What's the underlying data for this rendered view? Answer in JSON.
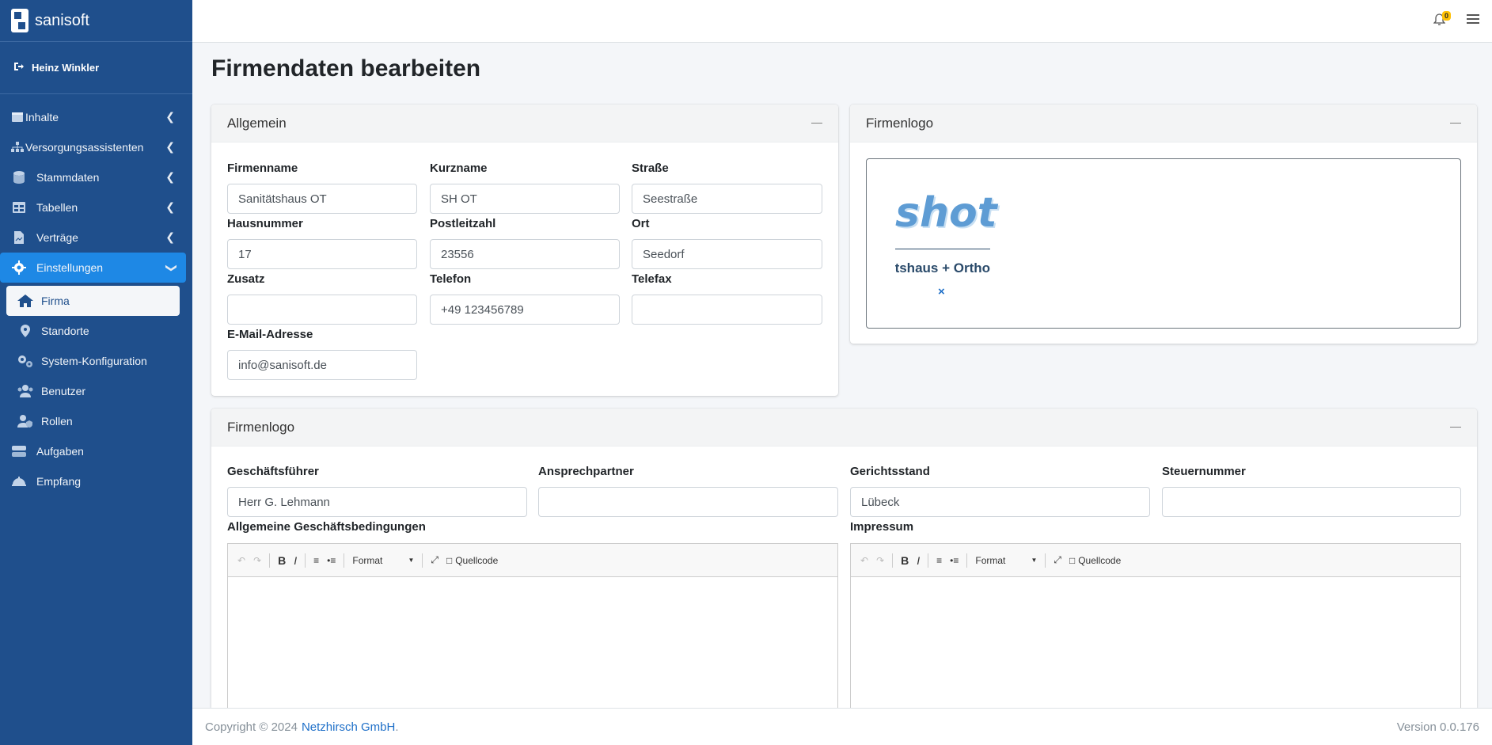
{
  "brand": {
    "name": "sanisoft"
  },
  "user": {
    "name": "Heinz Winkler"
  },
  "sidebar": {
    "items": [
      {
        "label": "Inhalte",
        "icon": "box-icon"
      },
      {
        "label": "Versorgungsassistenten",
        "icon": "sitemap-icon"
      },
      {
        "label": "Stammdaten",
        "icon": "database-icon"
      },
      {
        "label": "Tabellen",
        "icon": "table-icon"
      },
      {
        "label": "Verträge",
        "icon": "contract-icon"
      },
      {
        "label": "Einstellungen",
        "icon": "gear-icon"
      }
    ],
    "sub": [
      {
        "label": "Firma",
        "icon": "home-icon"
      },
      {
        "label": "Standorte",
        "icon": "location-icon"
      },
      {
        "label": "System-Konfiguration",
        "icon": "cogs-icon"
      },
      {
        "label": "Benutzer",
        "icon": "users-icon"
      },
      {
        "label": "Rollen",
        "icon": "user-shield-icon"
      }
    ],
    "bottom": [
      {
        "label": "Aufgaben",
        "icon": "tasks-icon"
      },
      {
        "label": "Empfang",
        "icon": "bell-service-icon"
      }
    ]
  },
  "topbar": {
    "notifications": "0"
  },
  "page": {
    "title": "Firmendaten bearbeiten"
  },
  "general": {
    "title": "Allgemein",
    "fields": {
      "firmenname": {
        "label": "Firmenname",
        "value": "Sanitätshaus OT"
      },
      "kurzname": {
        "label": "Kurzname",
        "value": "SH OT"
      },
      "strasse": {
        "label": "Straße",
        "value": "Seestraße"
      },
      "hausnummer": {
        "label": "Hausnummer",
        "value": "17"
      },
      "plz": {
        "label": "Postleitzahl",
        "value": "23556"
      },
      "ort": {
        "label": "Ort",
        "value": "Seedorf"
      },
      "zusatz": {
        "label": "Zusatz",
        "value": ""
      },
      "telefon": {
        "label": "Telefon",
        "value": "+49 123456789"
      },
      "telefax": {
        "label": "Telefax",
        "value": ""
      },
      "email": {
        "label": "E-Mail-Adresse",
        "value": "info@sanisoft.de"
      }
    }
  },
  "logo_card": {
    "title": "Firmenlogo",
    "logo_word": "shot",
    "logo_subtitle": "Sanitätshaus + Ortho",
    "remove": "×"
  },
  "legal": {
    "title": "Firmenlogo",
    "fields": {
      "geschaeftsfuehrer": {
        "label": "Geschäftsführer",
        "value": "Herr G. Lehmann"
      },
      "ansprechpartner": {
        "label": "Ansprechpartner",
        "value": ""
      },
      "gerichtsstand": {
        "label": "Gerichtsstand",
        "value": "Lübeck"
      },
      "steuernummer": {
        "label": "Steuernummer",
        "value": ""
      }
    },
    "agb_label": "Allgemeine Geschäftsbedingungen",
    "impressum_label": "Impressum"
  },
  "editor": {
    "format": "Format",
    "source": "Quellcode"
  },
  "footer": {
    "copyright": "Copyright © 2024",
    "company": "Netzhirsch GmbH",
    "version": "Version 0.0.176"
  }
}
